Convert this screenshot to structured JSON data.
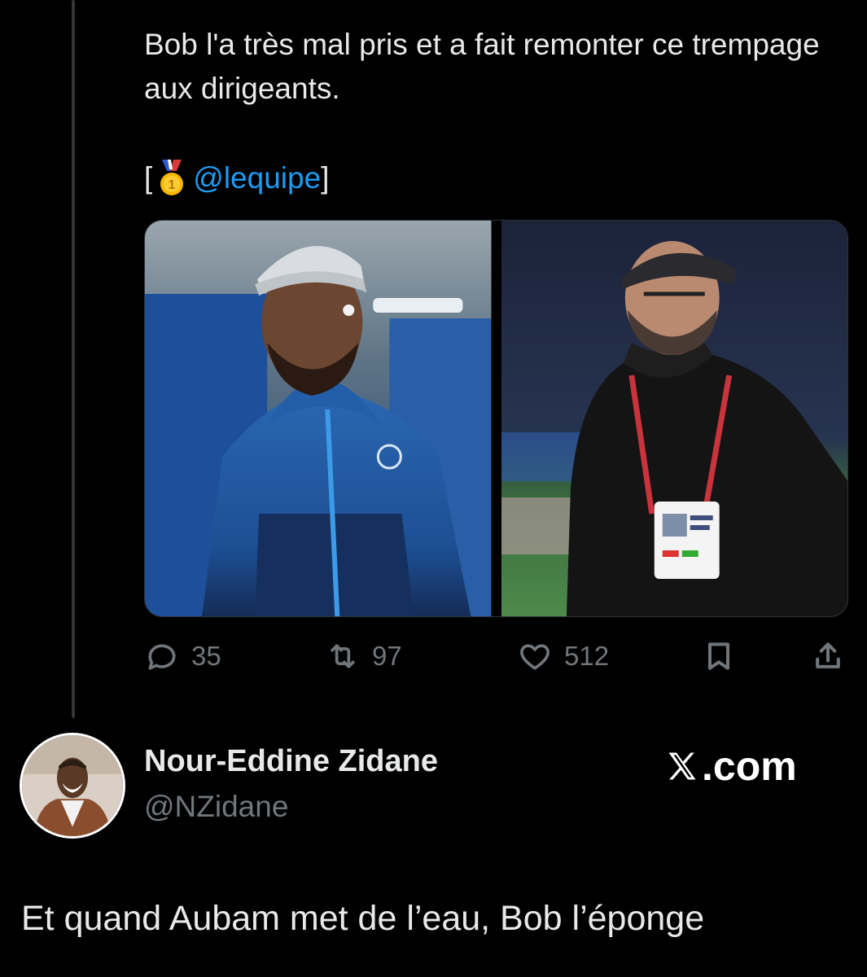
{
  "tweet": {
    "text": "Bob l'a très mal pris et a fait remonter ce trempage aux dirigeants.",
    "source_open": "[",
    "source_mention": "@lequipe",
    "source_close": "]",
    "medal_icon": "first-place-medal-icon",
    "media": [
      {
        "description": "Photo 1"
      },
      {
        "description": "Photo 2"
      }
    ],
    "actions": {
      "replies": "35",
      "reposts": "97",
      "likes": "512"
    }
  },
  "quote_author": {
    "name": "Nour-Eddine Zidane",
    "handle": "@NZidane"
  },
  "brand": {
    "suffix": ".com"
  },
  "reply_text": "Et quand Aubam met de l’eau, Bob l’éponge",
  "colors": {
    "background": "#000000",
    "text": "#e7e9ea",
    "muted": "#71767b",
    "accent": "#1d9bf0"
  }
}
